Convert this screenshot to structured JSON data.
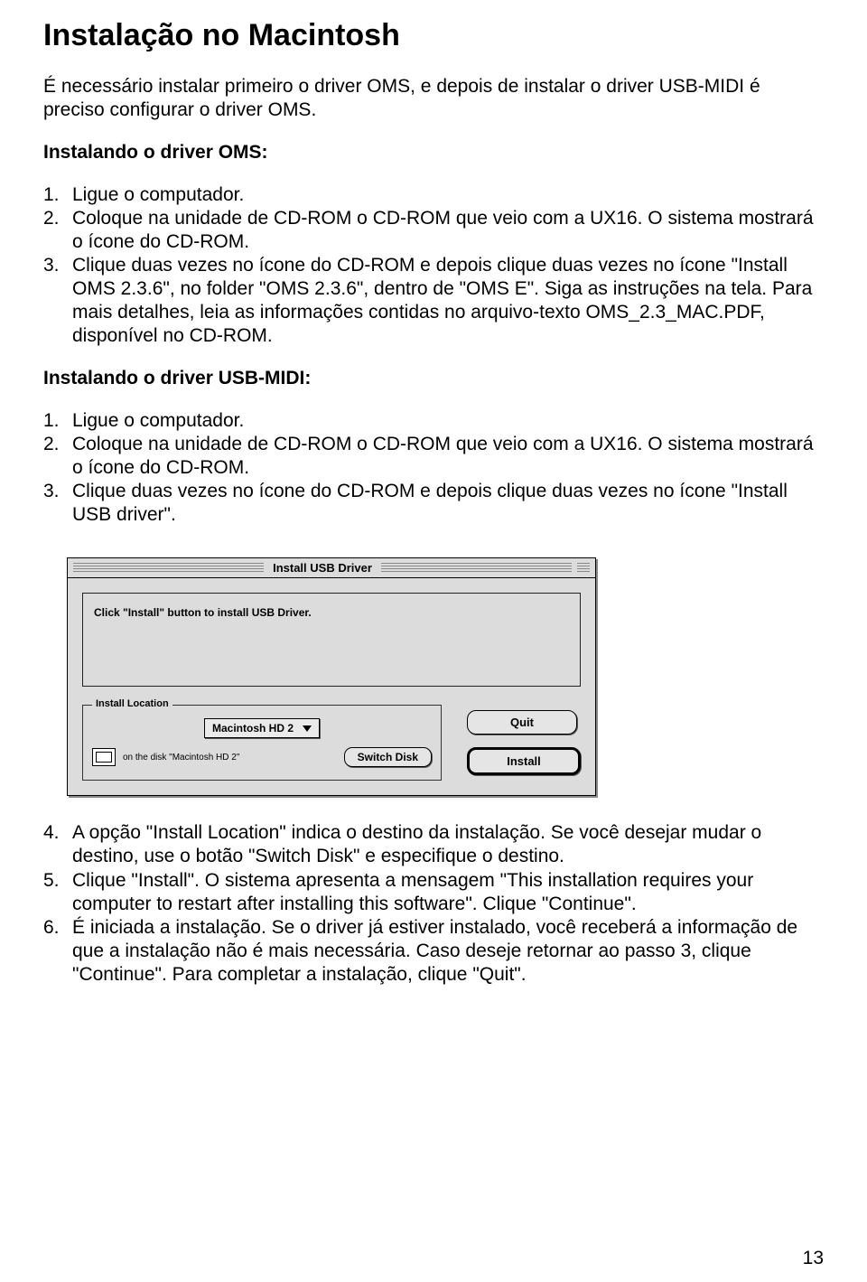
{
  "title": "Instalação no Macintosh",
  "intro": "É necessário instalar primeiro o driver OMS, e depois de instalar o driver USB-MIDI é preciso configurar o driver OMS.",
  "section_oms": {
    "heading": "Instalando o driver OMS:",
    "steps": [
      "Ligue o computador.",
      "Coloque na unidade de CD-ROM o CD-ROM que veio com a UX16. O sistema mostrará o ícone do CD-ROM.",
      "Clique duas vezes no ícone do CD-ROM e depois clique duas vezes no ícone \"Install OMS 2.3.6\", no folder \"OMS 2.3.6\", dentro de \"OMS E\". Siga as instruções na tela. Para mais detalhes, leia as informações contidas no arquivo-texto OMS_2.3_MAC.PDF, disponível no CD-ROM."
    ]
  },
  "section_usb": {
    "heading": "Instalando o driver USB-MIDI:",
    "steps_a": [
      "Ligue o computador.",
      "Coloque na unidade de CD-ROM o CD-ROM que veio com a UX16. O sistema mostrará o ícone do CD-ROM.",
      "Clique duas vezes no ícone do CD-ROM e depois clique duas vezes no ícone \"Install USB driver\"."
    ],
    "steps_b_start": 4,
    "steps_b": [
      "A opção \"Install Location\" indica o destino da instalação. Se você desejar mudar o destino, use o botão \"Switch Disk\" e especifique o destino.",
      "Clique \"Install\". O sistema apresenta a mensagem \"This installation requires your computer to restart after installing this software\". Clique \"Continue\".",
      "É iniciada a instalação. Se o driver já estiver instalado, você receberá a informação de que a instalação não é mais necessária. Caso deseje retornar ao passo 3, clique \"Continue\". Para completar a instalação, clique \"Quit\"."
    ]
  },
  "dialog": {
    "title": "Install USB Driver",
    "message": "Click \"Install\" button to install USB Driver.",
    "location_legend": "Install Location",
    "disk_select": "Macintosh HD 2",
    "on_disk_text": "on the disk \"Macintosh HD 2\"",
    "switch_disk": "Switch Disk",
    "quit": "Quit",
    "install": "Install"
  },
  "page_number": "13"
}
